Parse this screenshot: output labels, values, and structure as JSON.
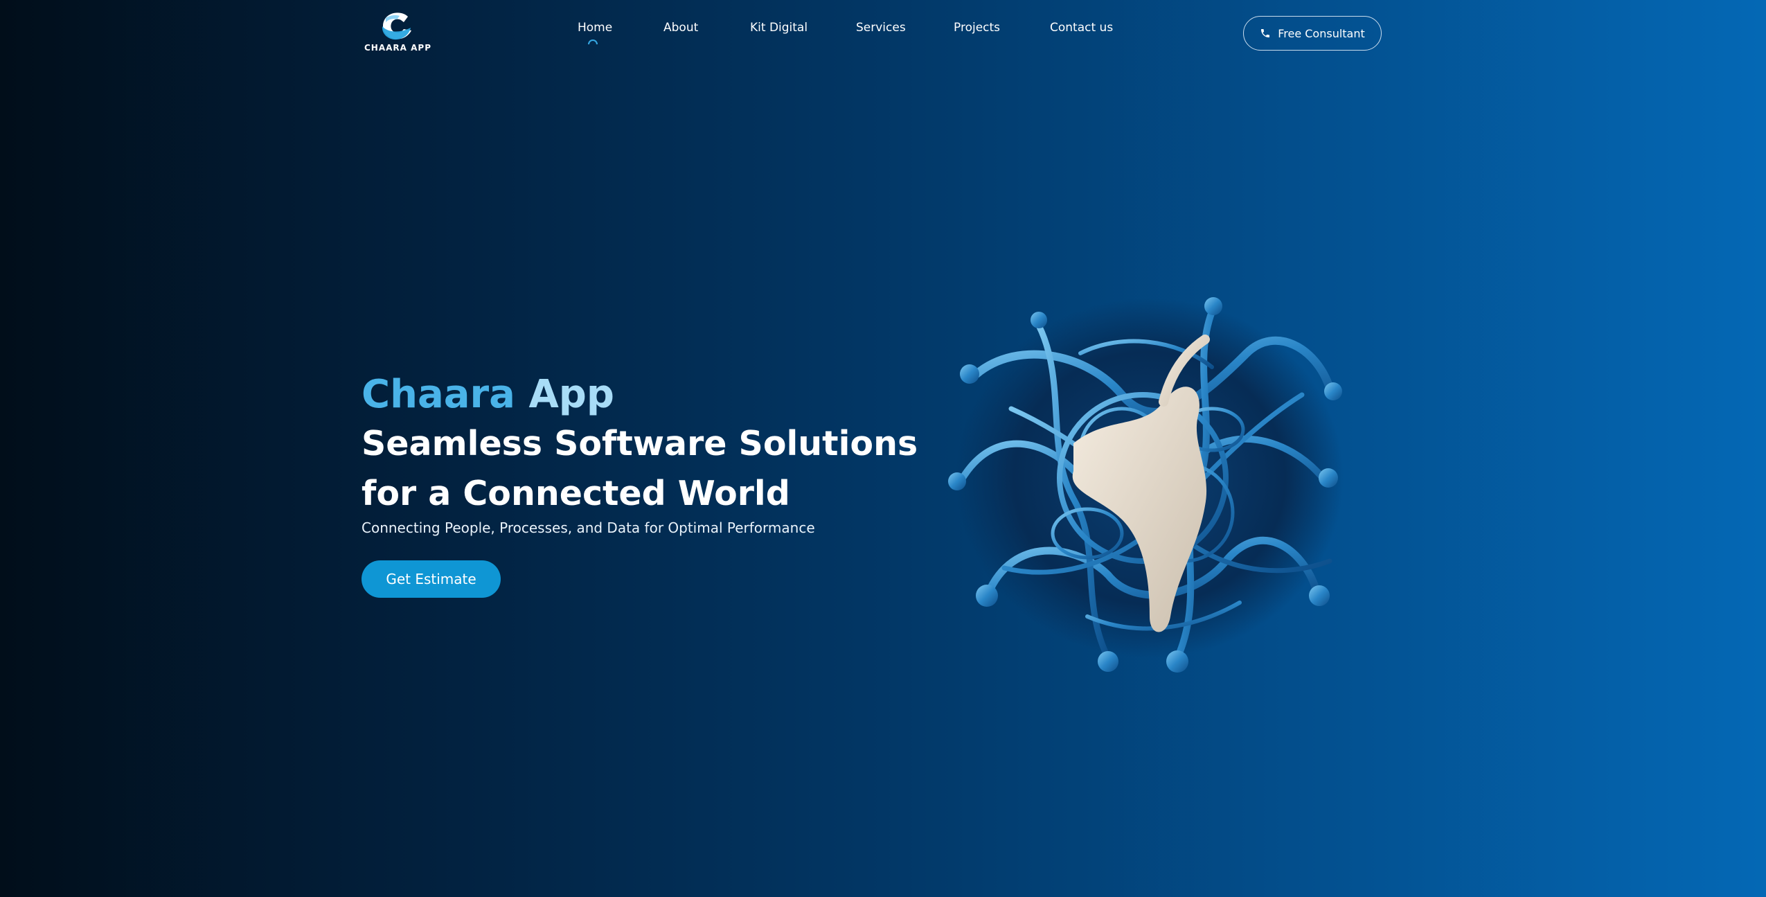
{
  "header": {
    "logo_text": "CHAARA APP",
    "nav": [
      {
        "label": "Home",
        "active": true
      },
      {
        "label": "About"
      },
      {
        "label": "Kit Digital"
      },
      {
        "label": "Services"
      },
      {
        "label": "Projects"
      },
      {
        "label": "Contact us"
      }
    ],
    "cta_label": "Free Consultant",
    "cta_icon": "phone-icon"
  },
  "hero": {
    "brand_first": "Chaara",
    "brand_second": "App",
    "headline_line1": "Seamless Software Solutions",
    "headline_line2": "for a Connected World",
    "subheadline": "Connecting People, Processes, and Data for Optimal Performance",
    "button_label": "Get Estimate",
    "image_icon": "abstract-3d-sculpture"
  },
  "colors": {
    "accent": "#0f96d4",
    "brand_blue": "#4ab3e8",
    "brand_light": "#a8dcf7",
    "bg_dark": "#010e1a",
    "bg_light": "#0468b5"
  }
}
